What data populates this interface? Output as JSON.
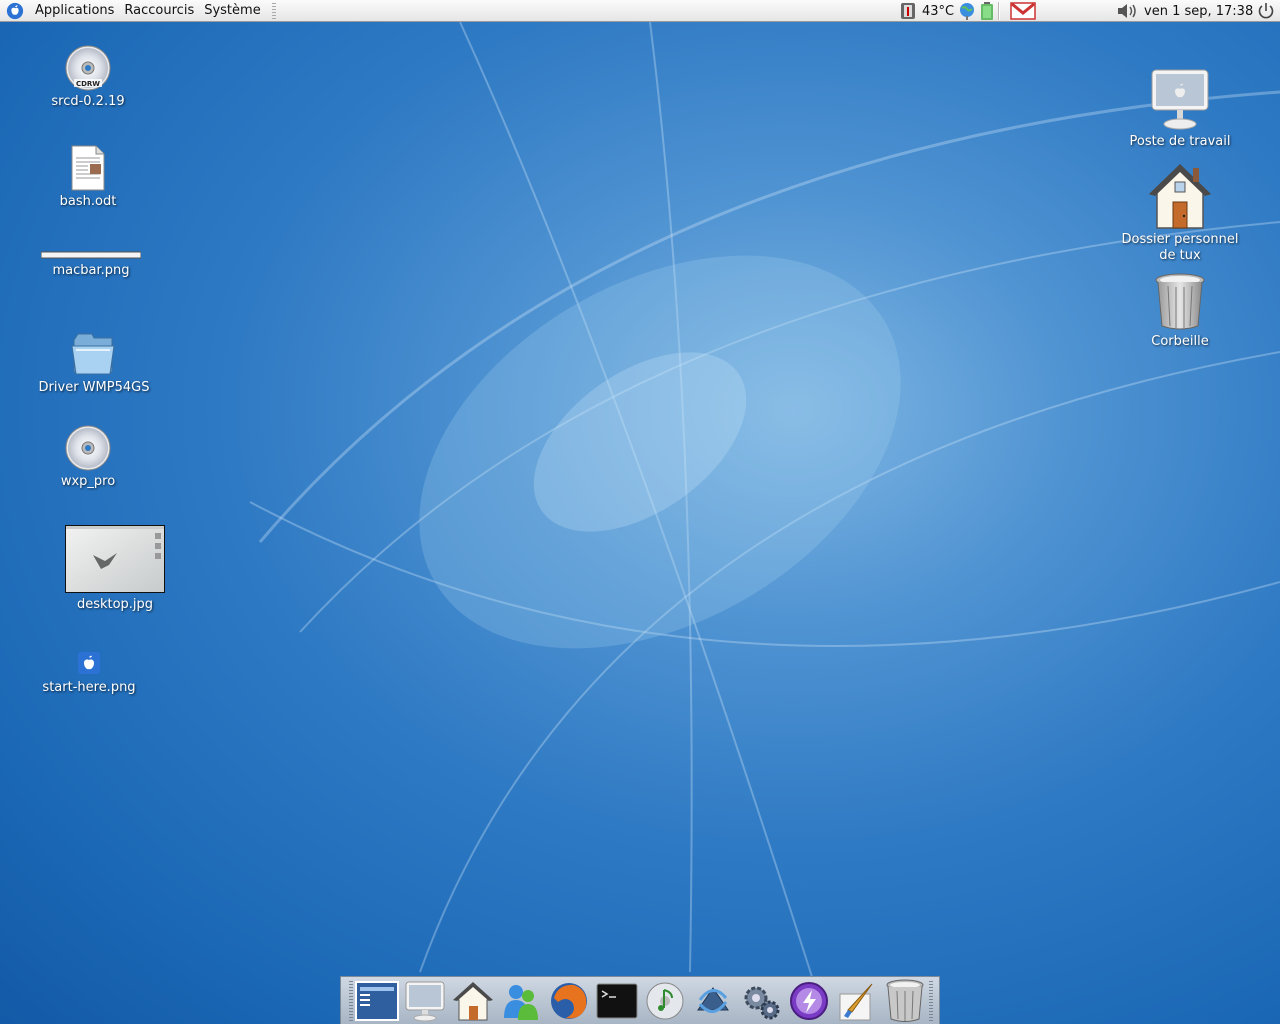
{
  "panel": {
    "menus": [
      "Applications",
      "Raccourcis",
      "Système"
    ],
    "temperature": "43°C",
    "datetime": "ven  1 sep, 17:38"
  },
  "desktop_left": [
    {
      "label": "srcd-0.2.19",
      "icon": "cdrw-disc-icon"
    },
    {
      "label": "bash.odt",
      "icon": "document-icon"
    },
    {
      "label": "macbar.png",
      "icon": "image-bar-icon"
    },
    {
      "label": "Driver WMP54GS",
      "icon": "folder-icon"
    },
    {
      "label": "wxp_pro",
      "icon": "cd-disc-icon"
    },
    {
      "label": "desktop.jpg",
      "icon": "image-thumbnail-icon"
    },
    {
      "label": "start-here.png",
      "icon": "apple-logo-icon"
    }
  ],
  "desktop_right": [
    {
      "label": "Poste de travail",
      "icon": "computer-icon"
    },
    {
      "label_line1": "Dossier personnel",
      "label_line2": "de tux",
      "icon": "home-folder-icon"
    },
    {
      "label": "Corbeille",
      "icon": "trash-icon"
    }
  ],
  "dock_items": [
    "desktop-switcher-icon",
    "computer-icon",
    "home-icon",
    "messenger-icon",
    "firefox-icon",
    "terminal-icon",
    "music-player-icon",
    "update-icon",
    "settings-gears-icon",
    "lightning-app-icon",
    "paint-brush-icon",
    "trash-icon"
  ],
  "colors": {
    "desktop_blue": "#1b68b6",
    "panel_bg": "#eeeeee",
    "dock_bg": "#b8c4d2"
  }
}
